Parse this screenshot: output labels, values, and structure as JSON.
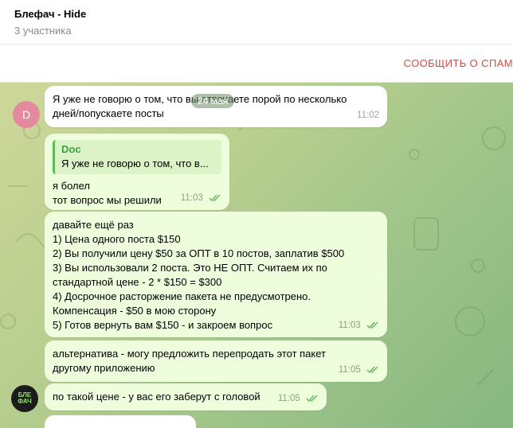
{
  "header": {
    "title": "Блефач - Hide",
    "subtitle": "3 участника"
  },
  "report": {
    "label": "СООБЩИТЬ О СПАМ"
  },
  "chat": {
    "date": "24 мая",
    "messages": [
      {
        "id": "m1",
        "direction": "in",
        "avatar_letter": "D",
        "text": "Я уже не говорю о том, что вы отвечаете порой по несколько\nдней/попускаете посты",
        "time": "11:02"
      },
      {
        "id": "m2",
        "direction": "out",
        "reply_name": "Doc",
        "reply_text": "Я уже не говорю о том, что в...",
        "text": "я болел\nтот вопрос мы решили",
        "time": "11:03"
      },
      {
        "id": "m3",
        "direction": "out",
        "text": "давайте ещё раз\n1) Цена одного поста $150\n2) Вы получили цену $50 за ОПТ в 10 постов, заплатив $500\n3) Вы использовали 2 поста. Это НЕ ОПТ. Считаем их по\nстандартной цене - 2 * $150 = $300\n4) Досрочное расторжение пакета не предусмотрено.\nКомпенсация - $50 в мою сторону\n5) Готов вернуть вам $150 - и закроем вопрос",
        "time": "11:03"
      },
      {
        "id": "m4",
        "direction": "out",
        "text": "альтернатива - могу предложить перепродать этот пакет\nдругому приложению",
        "time": "11:05"
      },
      {
        "id": "m5",
        "direction": "out",
        "text": "по такой цене - у вас его заберут с головой",
        "time": "11:05"
      }
    ],
    "logo_text": "БЛЕ ФАЧ"
  },
  "colors": {
    "accent_green": "#4fae4e",
    "report_red": "#e0463f",
    "out_bubble": "#eefedd",
    "in_bubble": "#ffffff"
  }
}
